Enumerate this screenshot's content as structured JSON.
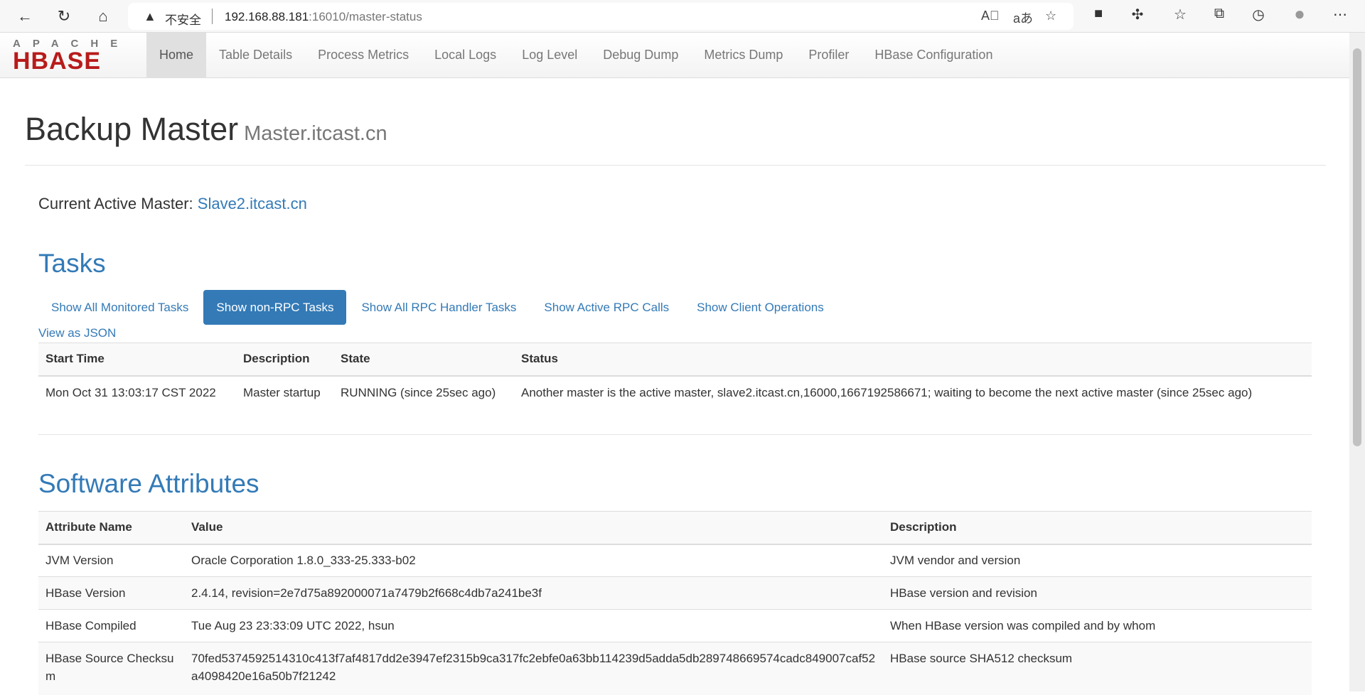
{
  "browser": {
    "insecure_label": "不安全",
    "url_host": "192.168.88.181",
    "url_rest": ":16010/master-status"
  },
  "logo": {
    "top": "APACHE",
    "main": "HBASE"
  },
  "nav": [
    "Home",
    "Table Details",
    "Process Metrics",
    "Local Logs",
    "Log Level",
    "Debug Dump",
    "Metrics Dump",
    "Profiler",
    "HBase Configuration"
  ],
  "page": {
    "title": "Backup Master",
    "subtitle": "Master.itcast.cn",
    "active_master_label": "Current Active Master:",
    "active_master": "Slave2.itcast.cn"
  },
  "tasks": {
    "title": "Tasks",
    "tabs": [
      "Show All Monitored Tasks",
      "Show non-RPC Tasks",
      "Show All RPC Handler Tasks",
      "Show Active RPC Calls",
      "Show Client Operations"
    ],
    "active_tab": 1,
    "view_json": "View as JSON",
    "columns": [
      "Start Time",
      "Description",
      "State",
      "Status"
    ],
    "rows": [
      [
        "Mon Oct 31 13:03:17 CST 2022",
        "Master startup",
        "RUNNING (since 25sec ago)",
        "Another master is the active master, slave2.itcast.cn,16000,1667192586671; waiting to become the next active master (since 25sec ago)"
      ]
    ]
  },
  "software": {
    "title": "Software Attributes",
    "columns": [
      "Attribute Name",
      "Value",
      "Description"
    ],
    "rows": [
      [
        "JVM Version",
        "Oracle Corporation 1.8.0_333-25.333-b02",
        "JVM vendor and version"
      ],
      [
        "HBase Version",
        "2.4.14, revision=2e7d75a892000071a7479b2f668c4db7a241be3f",
        "HBase version and revision"
      ],
      [
        "HBase Compiled",
        "Tue Aug 23 23:33:09 UTC 2022, hsun",
        "When HBase version was compiled and by whom"
      ],
      [
        "HBase Source Checksum",
        "70fed5374592514310c413f7af4817dd2e3947ef2315b9ca317fc2ebfe0a63bb114239d5adda5db289748669574cadc849007caf52a4098420e16a50b7f21242",
        "HBase source SHA512 checksum"
      ]
    ]
  }
}
